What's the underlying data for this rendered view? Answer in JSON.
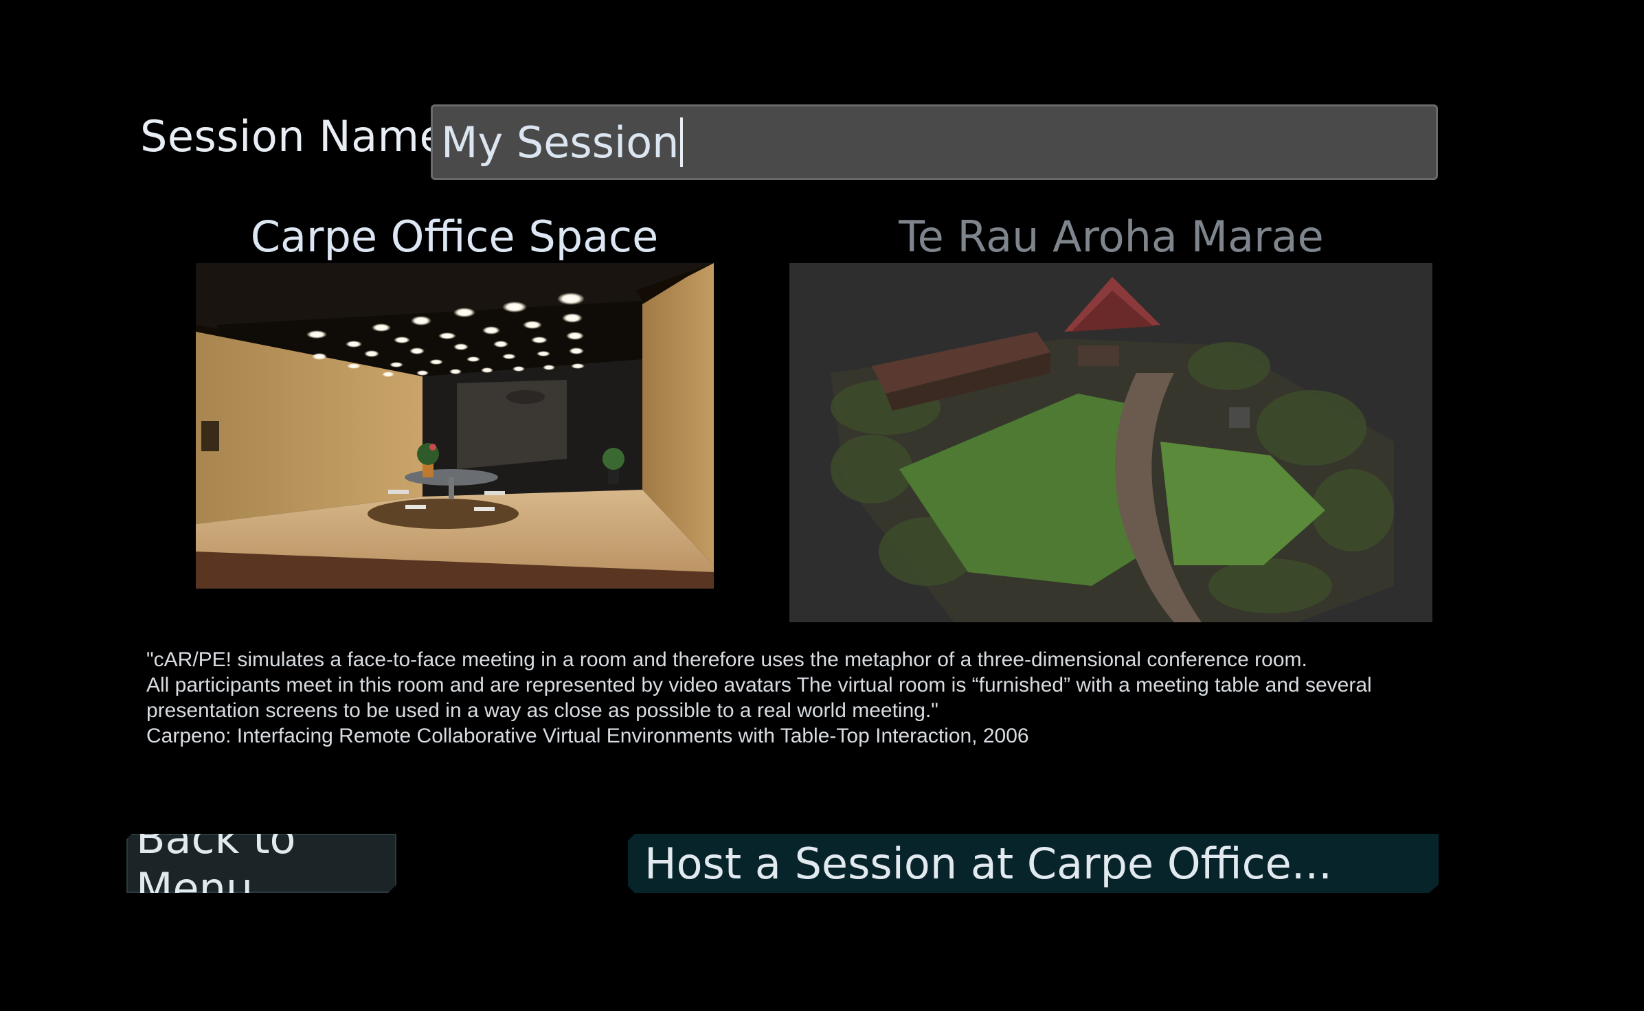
{
  "session": {
    "label": "Session Name:",
    "value": "My Session"
  },
  "environments": [
    {
      "name": "Carpe Office Space",
      "selected": true
    },
    {
      "name": "Te Rau Aroha Marae",
      "selected": false
    }
  ],
  "description": {
    "lines": [
      "\"cAR/PE! simulates a face-to-face meeting in a room and therefore uses the metaphor of a three-dimensional conference room.",
      "All participants meet in this room and are represented by video avatars  The virtual room is “furnished” with a meeting table and several",
      "presentation screens to be used in a way as close as possible to a real world meeting.\"",
      "Carpeno: Interfacing Remote Collaborative Virtual Environments with Table-Top Interaction, 2006"
    ]
  },
  "buttons": {
    "back": "Back to Menu",
    "host": "Host a Session at Carpe Office..."
  },
  "colors": {
    "background": "#000000",
    "input_bg": "#4a4a4a",
    "selected_title": "#dde7f3",
    "unselected_title": "#7e858d",
    "host_button_bg": "#06242a",
    "back_button_bg": "#1b2528"
  }
}
